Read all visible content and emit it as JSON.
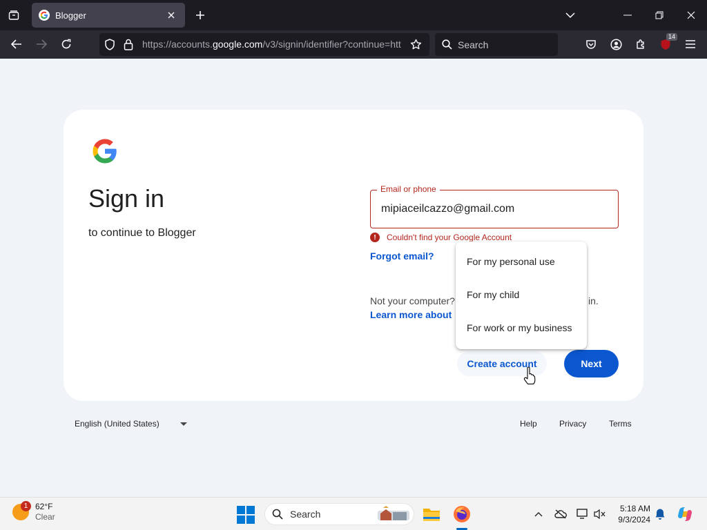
{
  "browser": {
    "tab": {
      "title": "Blogger"
    },
    "url": {
      "prefix": "https://accounts.",
      "domain": "google.com",
      "suffix": "/v3/signin/identifier?continue=htt"
    },
    "search_placeholder": "Search",
    "extension_badge": "14"
  },
  "signin": {
    "title": "Sign in",
    "subtitle": "to continue to Blogger",
    "email_label": "Email or phone",
    "email_value": "mipiaceilcazzo@gmail.com",
    "error_text": "Couldn't find your Google Account",
    "forgot_email": "Forgot email?",
    "not_your_computer": "Not your computer?",
    "not_your_computer_tail": "in.",
    "learn_more": "Learn more about",
    "create_account": "Create account",
    "next": "Next"
  },
  "create_menu": {
    "items": [
      "For my personal use",
      "For my child",
      "For work or my business"
    ]
  },
  "footer": {
    "language": "English (United States)",
    "links": [
      "Help",
      "Privacy",
      "Terms"
    ]
  },
  "taskbar": {
    "weather_temp": "62°F",
    "weather_cond": "Clear",
    "weather_badge": "1",
    "search_placeholder": "Search",
    "time": "5:18 AM",
    "date": "9/3/2024"
  },
  "colors": {
    "accent": "#0b57d0",
    "error": "#b3261e",
    "chrome_dark": "#1c1b22"
  }
}
